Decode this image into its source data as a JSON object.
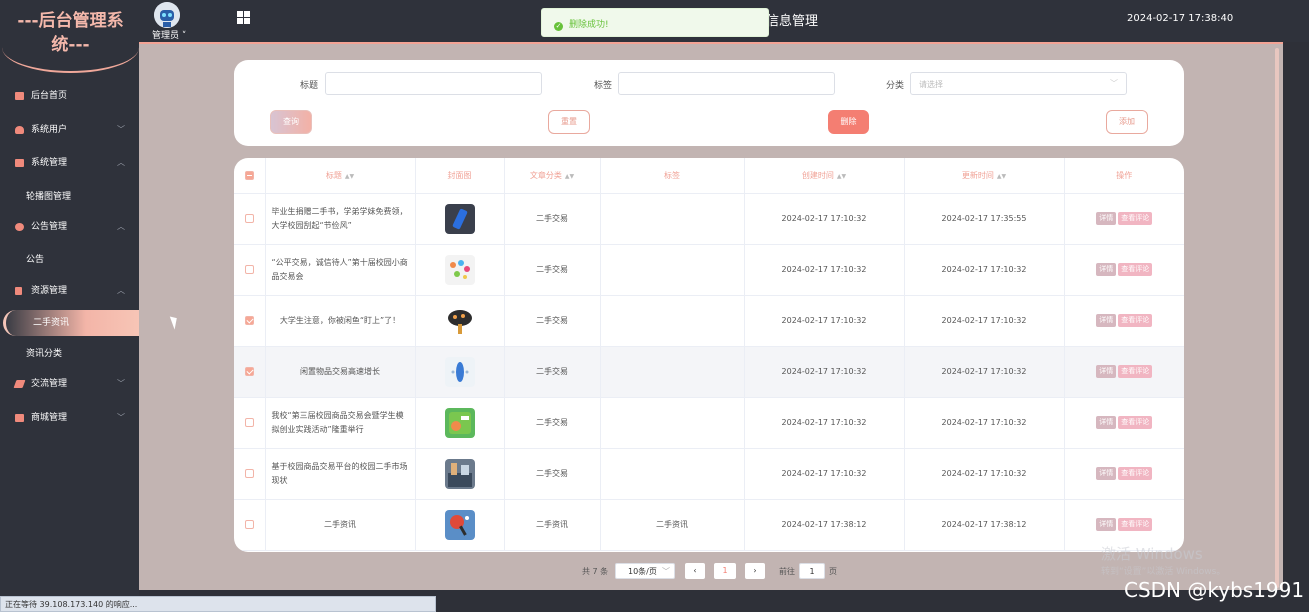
{
  "header": {
    "logo_text": "---后台管理系统---",
    "admin_label": "管理员",
    "page_title": "信息管理",
    "datetime": "2024-02-17 17:38:40"
  },
  "toast": {
    "message": "删除成功!"
  },
  "sidebar": {
    "items": [
      {
        "label": "后台首页"
      },
      {
        "label": "系统用户"
      },
      {
        "label": "系统管理"
      },
      {
        "label": "轮播图管理"
      },
      {
        "label": "公告管理"
      },
      {
        "label": "公告"
      },
      {
        "label": "资源管理"
      },
      {
        "label": "二手资讯"
      },
      {
        "label": "资讯分类"
      },
      {
        "label": "交流管理"
      },
      {
        "label": "商城管理"
      }
    ]
  },
  "search": {
    "title_label": "标题",
    "tag_label": "标签",
    "category_label": "分类",
    "category_placeholder": "请选择",
    "query_label": "查询",
    "reset_label": "重置",
    "delete_label": "删除",
    "add_label": "添加"
  },
  "table": {
    "headers": [
      "标题",
      "封面图",
      "文章分类",
      "标签",
      "创建时间",
      "更新时间",
      "操作"
    ],
    "detail_label": "详情",
    "comment_label": "查看评论",
    "rows": [
      {
        "title": "毕业生捐赠二手书，学弟学妹免费领，大学校园刮起“节俭风”",
        "category": "二手交易",
        "tag": "",
        "created": "2024-02-17 17:10:32",
        "updated": "2024-02-17 17:35:55",
        "selected": false
      },
      {
        "title": "“公平交易，诚信待人”第十届校园小商品交易会",
        "category": "二手交易",
        "tag": "",
        "created": "2024-02-17 17:10:32",
        "updated": "2024-02-17 17:10:32",
        "selected": false
      },
      {
        "title": "大学生注意，你被闲鱼“盯上”了！",
        "category": "二手交易",
        "tag": "",
        "created": "2024-02-17 17:10:32",
        "updated": "2024-02-17 17:10:32",
        "selected": true
      },
      {
        "title": "闲置物品交易高速增长",
        "category": "二手交易",
        "tag": "",
        "created": "2024-02-17 17:10:32",
        "updated": "2024-02-17 17:10:32",
        "selected": true
      },
      {
        "title": "我校“第三届校园商品交易会暨学生模拟创业实践活动”隆重举行",
        "category": "二手交易",
        "tag": "",
        "created": "2024-02-17 17:10:32",
        "updated": "2024-02-17 17:10:32",
        "selected": false
      },
      {
        "title": "基于校园商品交易平台的校园二手市场现状",
        "category": "二手交易",
        "tag": "",
        "created": "2024-02-17 17:10:32",
        "updated": "2024-02-17 17:10:32",
        "selected": false
      },
      {
        "title": "二手资讯",
        "category": "二手资讯",
        "tag": "二手资讯",
        "created": "2024-02-17 17:38:12",
        "updated": "2024-02-17 17:38:12",
        "selected": false
      }
    ]
  },
  "pagination": {
    "total": "共 7 条",
    "page_size": "10条/页",
    "current_page": "1",
    "goto_label": "前往",
    "goto_value": "1",
    "page_suffix": "页"
  },
  "overlay": {
    "watermark": "激活 Windows",
    "watermark_sub": "转到“设置”以激活 Windows。",
    "csdn": "CSDN @kybs1991",
    "status": "正在等待 39.108.173.140 的响应..."
  },
  "colors": {
    "accent": "#f47e72",
    "pink": "#f3b1a6",
    "main_bg": "#c2b4b2",
    "dark": "#2f323b"
  }
}
